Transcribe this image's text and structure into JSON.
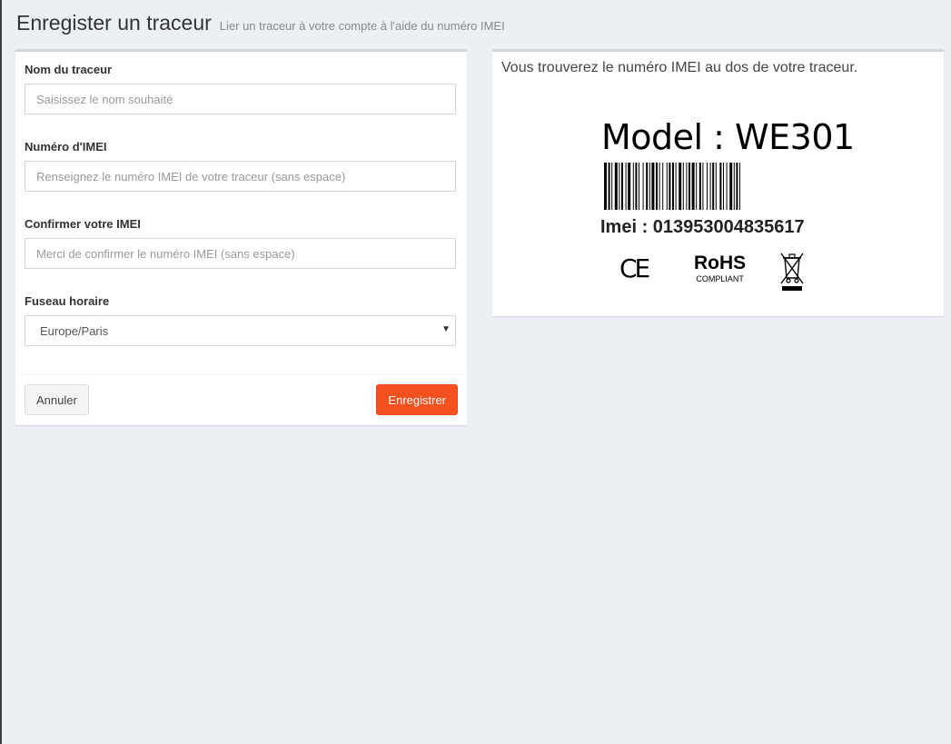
{
  "header": {
    "title": "Enregister un traceur",
    "subtitle": "Lier un traceur à votre compte à l'aide du numéro IMEI"
  },
  "form": {
    "name": {
      "label": "Nom du traceur",
      "placeholder": "Saisissez le nom souhaité",
      "value": ""
    },
    "imei": {
      "label": "Numéro d'IMEI",
      "placeholder": "Renseignez le numéro IMEI de votre traceur (sans espace)",
      "value": ""
    },
    "confirm_imei": {
      "label": "Confirmer votre IMEI",
      "placeholder": "Merci de confirmer le numéro IMEI (sans espace)",
      "value": ""
    },
    "timezone": {
      "label": "Fuseau horaire",
      "selected": "Europe/Paris"
    },
    "cancel_label": "Annuler",
    "save_label": "Enregistrer"
  },
  "info": {
    "text": "Vous trouverez le numéro IMEI au dos de votre traceur.",
    "model_text": "Model : WE301",
    "imei_text": "Imei : 013953004835617",
    "ce_mark": "CE",
    "rohs_title": "RoHS",
    "rohs_sub": "COMPLIANT",
    "icons": [
      "barcode-icon",
      "ce-icon",
      "rohs-icon",
      "weee-icon"
    ]
  },
  "colors": {
    "accent": "#f4511e",
    "background": "#ecf0f5"
  }
}
